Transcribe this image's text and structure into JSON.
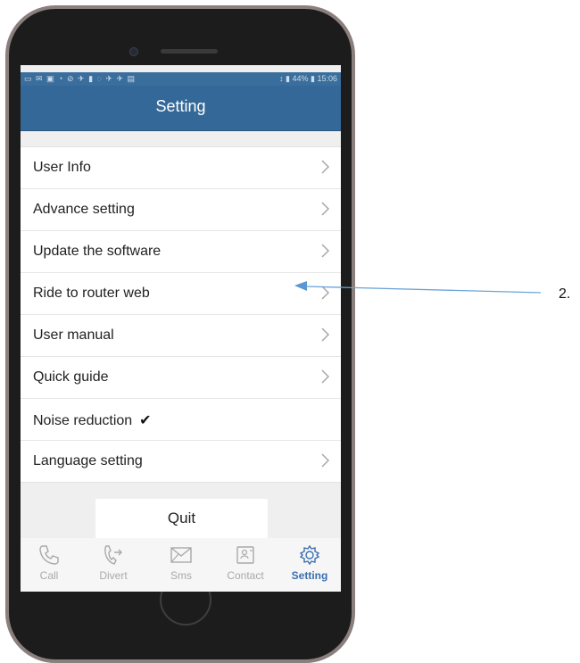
{
  "status_bar": {
    "right_text": "↕ ▮ 44% ▮ 15:06"
  },
  "header": {
    "title": "Setting"
  },
  "menu": {
    "items": [
      {
        "label": "User Info",
        "chevron": true
      },
      {
        "label": "Advance setting",
        "chevron": true
      },
      {
        "label": "Update the software",
        "chevron": true
      },
      {
        "label": "Ride to router web",
        "chevron": true
      },
      {
        "label": "User manual",
        "chevron": true
      },
      {
        "label": "Quick guide",
        "chevron": true
      },
      {
        "label": "Noise reduction",
        "checked": true
      },
      {
        "label": "Language setting",
        "chevron": true
      }
    ]
  },
  "quit_label": "Quit",
  "tabs": [
    {
      "label": "Call",
      "icon": "phone-icon"
    },
    {
      "label": "Divert",
      "icon": "divert-icon"
    },
    {
      "label": "Sms",
      "icon": "envelope-icon"
    },
    {
      "label": "Contact",
      "icon": "contact-card-icon"
    },
    {
      "label": "Setting",
      "icon": "gear-icon",
      "active": true
    }
  ],
  "annotation": {
    "label": "2."
  },
  "colors": {
    "header": "#346898",
    "active_tab": "#3b6fb0",
    "arrow": "#6aa3d8"
  }
}
